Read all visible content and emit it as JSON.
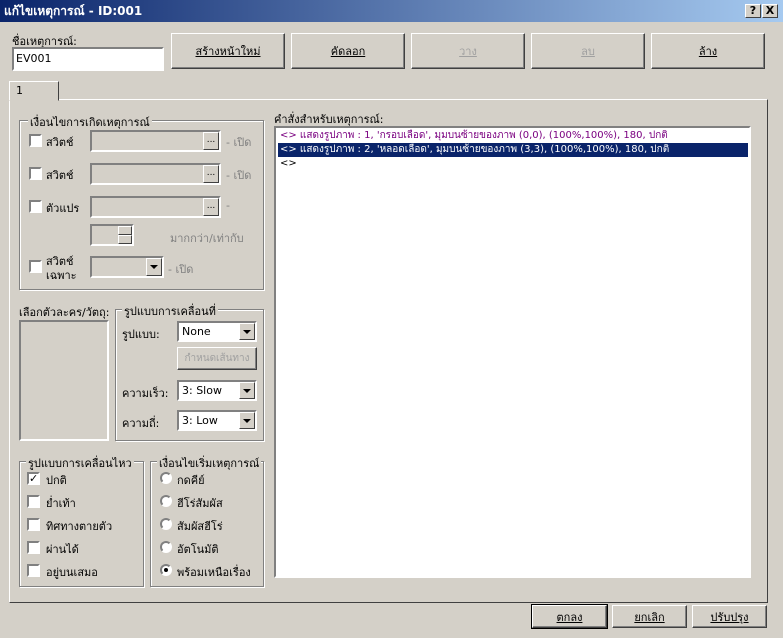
{
  "window": {
    "title": "แก้ไขเหตุการณ์ - ID:001",
    "help_label": "?",
    "close_label": "X"
  },
  "event_name": {
    "label": "ชื่อเหตุการณ์:",
    "value": "EV001"
  },
  "toolbar": {
    "new_page": "สร้างหน้าใหม่",
    "copy": "คัดลอก",
    "paste": "วาง",
    "delete": "ลบ",
    "clear": "ล้าง"
  },
  "tab": {
    "label": "1"
  },
  "conditions": {
    "title": "เงื่อนไขการเกิดเหตุการณ์",
    "switch1": {
      "label": "สวิตช์",
      "suffix": "- เปิด",
      "ellipsis": "..."
    },
    "switch2": {
      "label": "สวิตช์",
      "suffix": "- เปิด",
      "ellipsis": "..."
    },
    "variable": {
      "label": "ตัวแปร",
      "suffix": "-",
      "ellipsis": "..."
    },
    "compare_label": "มากกว่า/เท่ากับ",
    "self_switch": {
      "label_line1": "สวิตช์",
      "label_line2": "เฉพาะ",
      "suffix": "- เปิด"
    }
  },
  "graphic": {
    "label": "เลือกตัวละคร/วัตถุ:"
  },
  "movement_pattern": {
    "title": "รูปแบบการเคลื่อนที่",
    "type_label": "รูปแบบ:",
    "type_value": "None",
    "route_button": "กำหนดเส้นทาง",
    "speed_label": "ความเร็ว:",
    "speed_value": "3: Slow",
    "freq_label": "ความถี่:",
    "freq_value": "3: Low"
  },
  "movement_options": {
    "title": "รูปแบบการเคลื่อนไหว",
    "items": [
      {
        "label": "ปกติ",
        "checked": true
      },
      {
        "label": "ย่ำเท้า",
        "checked": false
      },
      {
        "label": "ทิศทางตายตัว",
        "checked": false
      },
      {
        "label": "ผ่านได้",
        "checked": false
      },
      {
        "label": "อยู่บนเสมอ",
        "checked": false
      }
    ]
  },
  "trigger": {
    "title": "เงื่อนไขเริ่มเหตุการณ์",
    "items": [
      {
        "label": "กดคีย์",
        "selected": false
      },
      {
        "label": "ฮีโร่สัมผัส",
        "selected": false
      },
      {
        "label": "สัมผัสฮีโร่",
        "selected": false
      },
      {
        "label": "อัตโนมัติ",
        "selected": false
      },
      {
        "label": "พร้อมเหนือเรื่อง",
        "selected": true
      }
    ]
  },
  "commands": {
    "label": "คำสั่งสำหรับเหตุการณ์:",
    "rows": [
      {
        "text": "<> แสดงรูปภาพ : 1, 'กรอบเลือด', มุมบนซ้ายของภาพ (0,0), (100%,100%), 180, ปกติ",
        "color": "#7a0080",
        "selected": false
      },
      {
        "text": "<> แสดงรูปภาพ : 2, 'หลอดเลือด', มุมบนซ้ายของภาพ (3,3), (100%,100%), 180, ปกติ",
        "color": "#ffffff",
        "selected": true
      },
      {
        "text": "<>",
        "color": "#000000",
        "selected": false
      }
    ]
  },
  "footer": {
    "ok": "ตกลง",
    "cancel": "ยกเลิก",
    "apply": "ปรับปรุง"
  },
  "colors": {
    "selection": "#0a246a",
    "titlebar": "#0a246a"
  }
}
